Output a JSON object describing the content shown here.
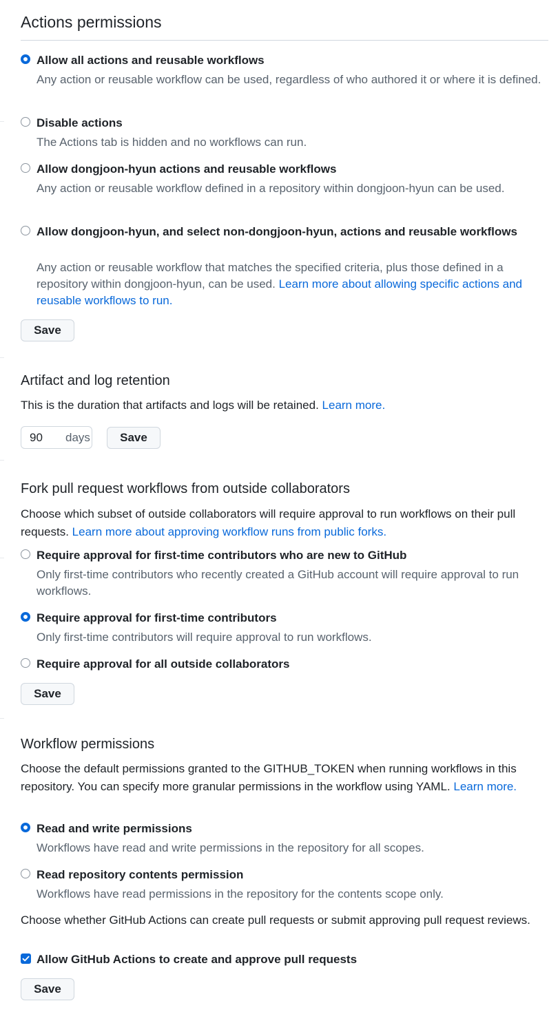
{
  "actions": {
    "title": "Actions permissions",
    "options": [
      {
        "label": "Allow all actions and reusable workflows",
        "desc": "Any action or reusable workflow can be used, regardless of who authored it or where it is defined.",
        "selected": true
      },
      {
        "label": "Disable actions",
        "desc": "The Actions tab is hidden and no workflows can run.",
        "selected": false
      },
      {
        "label": "Allow dongjoon-hyun actions and reusable workflows",
        "desc": "Any action or reusable workflow defined in a repository within dongjoon-hyun can be used.",
        "selected": false
      },
      {
        "label": "Allow dongjoon-hyun, and select non-dongjoon-hyun, actions and reusable workflows",
        "desc": "Any action or reusable workflow that matches the specified criteria, plus those defined in a repository within dongjoon-hyun, can be used.",
        "link": "Learn more about allowing specific actions and reusable workflows to run.",
        "selected": false
      }
    ],
    "save_label": "Save"
  },
  "retention": {
    "title": "Artifact and log retention",
    "desc": "This is the duration that artifacts and logs will be retained.",
    "link": "Learn more.",
    "value": "90",
    "unit": "days",
    "save_label": "Save"
  },
  "fork": {
    "title": "Fork pull request workflows from outside collaborators",
    "desc": "Choose which subset of outside collaborators will require approval to run workflows on their pull requests.",
    "link": "Learn more about approving workflow runs from public forks.",
    "options": [
      {
        "label": "Require approval for first-time contributors who are new to GitHub",
        "desc": "Only first-time contributors who recently created a GitHub account will require approval to run workflows.",
        "selected": false
      },
      {
        "label": "Require approval for first-time contributors",
        "desc": "Only first-time contributors will require approval to run workflows.",
        "selected": true
      },
      {
        "label": "Require approval for all outside collaborators",
        "desc": "",
        "selected": false
      }
    ],
    "save_label": "Save"
  },
  "workflow": {
    "title": "Workflow permissions",
    "desc": "Choose the default permissions granted to the GITHUB_TOKEN when running workflows in this repository. You can specify more granular permissions in the workflow using YAML.",
    "link": "Learn more.",
    "options": [
      {
        "label": "Read and write permissions",
        "desc": "Workflows have read and write permissions in the repository for all scopes.",
        "selected": true
      },
      {
        "label": "Read repository contents permission",
        "desc": "Workflows have read permissions in the repository for the contents scope only.",
        "selected": false
      }
    ],
    "pr_desc": "Choose whether GitHub Actions can create pull requests or submit approving pull request reviews.",
    "pr_checkbox_label": "Allow GitHub Actions to create and approve pull requests",
    "pr_checkbox_checked": true,
    "save_label": "Save"
  },
  "colors": {
    "accent": "#0969da",
    "muted_text": "#59636e",
    "border": "#d0d7de"
  }
}
